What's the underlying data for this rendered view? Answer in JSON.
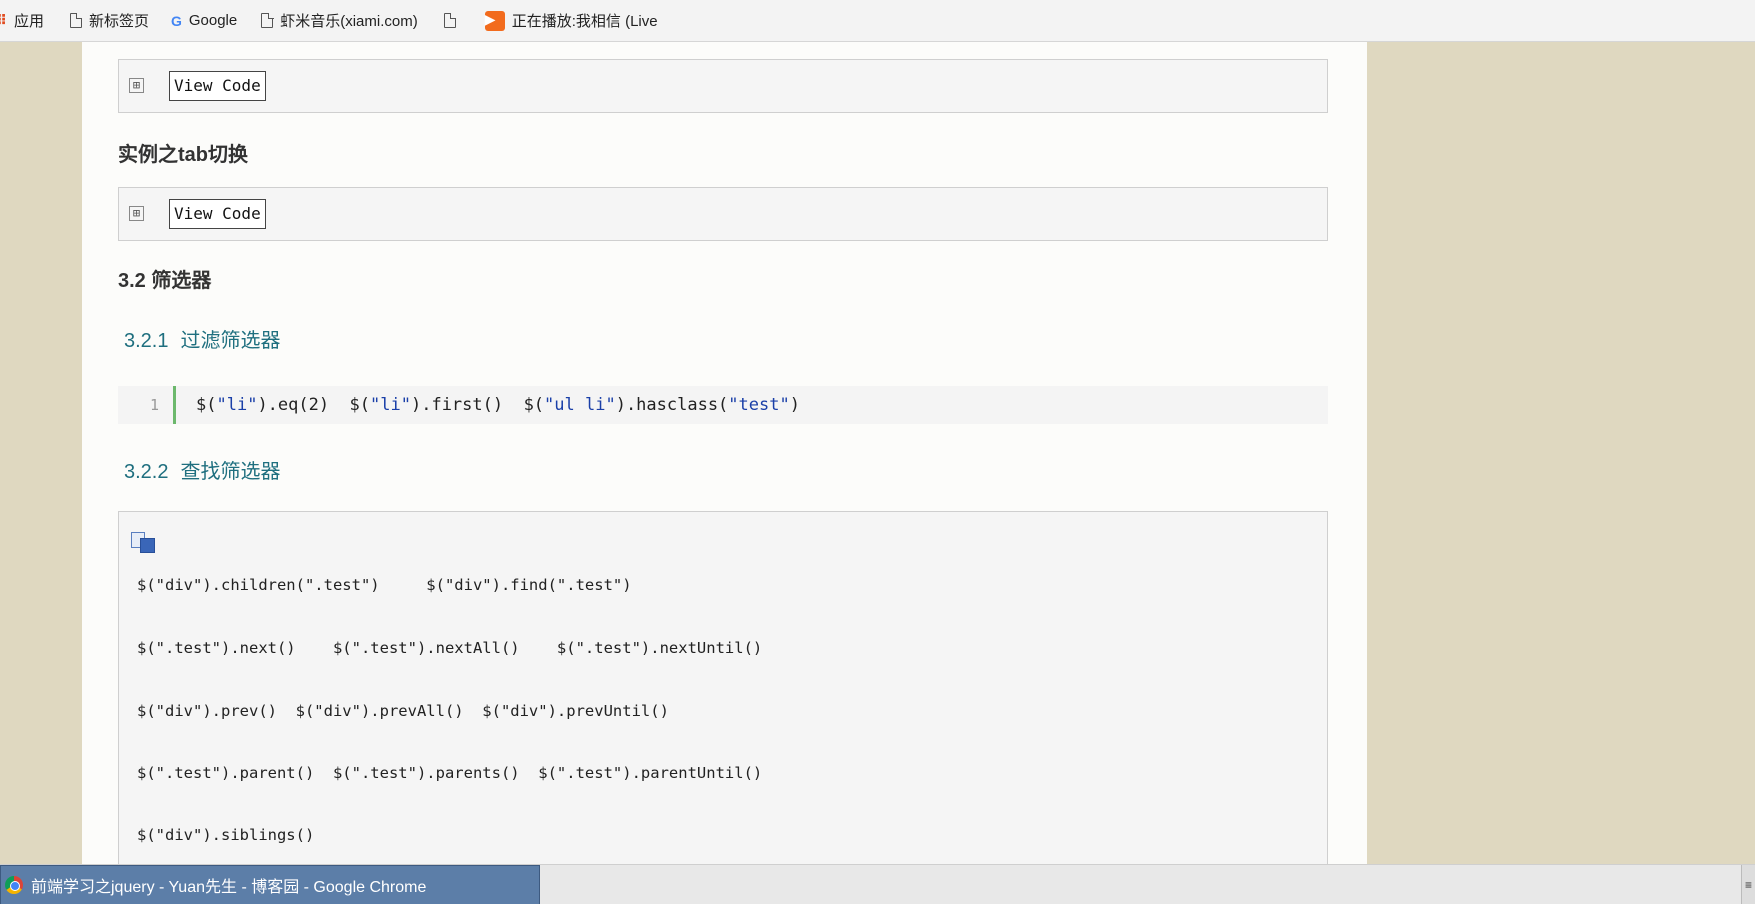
{
  "bookmarks": [
    {
      "label": "应用",
      "icon": "apps-icon"
    },
    {
      "label": "新标签页",
      "icon": "page-icon"
    },
    {
      "label": "Google",
      "icon": "google-icon"
    },
    {
      "label": "虾米音乐(xiami.com)",
      "icon": "page-icon"
    },
    {
      "label": "",
      "icon": "page-icon"
    },
    {
      "label": "正在播放:我相信 (Live",
      "icon": "play-icon"
    }
  ],
  "view_code_label": "View Code",
  "expand_glyph": "⊞",
  "sections": {
    "tab_example_title": "实例之tab切换",
    "filter_title": "3.2 筛选器",
    "sub1_num": "3.2.1",
    "sub1_title": "过滤筛选器",
    "sub2_num": "3.2.2",
    "sub2_title": "查找筛选器"
  },
  "code_line": {
    "line_number": "1",
    "parts": [
      {
        "t": "$(",
        "s": false
      },
      {
        "t": "\"li\"",
        "s": true
      },
      {
        "t": ").eq(2)  $(",
        "s": false
      },
      {
        "t": "\"li\"",
        "s": true
      },
      {
        "t": ").first()  $(",
        "s": false
      },
      {
        "t": "\"ul li\"",
        "s": true
      },
      {
        "t": ").hasclass(",
        "s": false
      },
      {
        "t": "\"test\"",
        "s": true
      },
      {
        "t": ")",
        "s": false
      }
    ]
  },
  "code_block": {
    "rows": [
      "$(\"div\").children(\".test\")     $(\"div\").find(\".test\")",
      "$(\".test\").next()    $(\".test\").nextAll()    $(\".test\").nextUntil()",
      "$(\"div\").prev()  $(\"div\").prevAll()  $(\"div\").prevUntil()",
      "$(\".test\").parent()  $(\".test\").parents()  $(\".test\").parentUntil()",
      "$(\"div\").siblings()"
    ]
  },
  "taskbar": {
    "window_title": "前端学习之jquery - Yuan先生 - 博客园 - Google Chrome",
    "right_glyph": "≡"
  },
  "colors": {
    "page_background": "#dfd8c0",
    "heading_teal": "#1f6f7f",
    "string_blue": "#1a3fa8",
    "taskbar_active": "#5c7ea8"
  }
}
